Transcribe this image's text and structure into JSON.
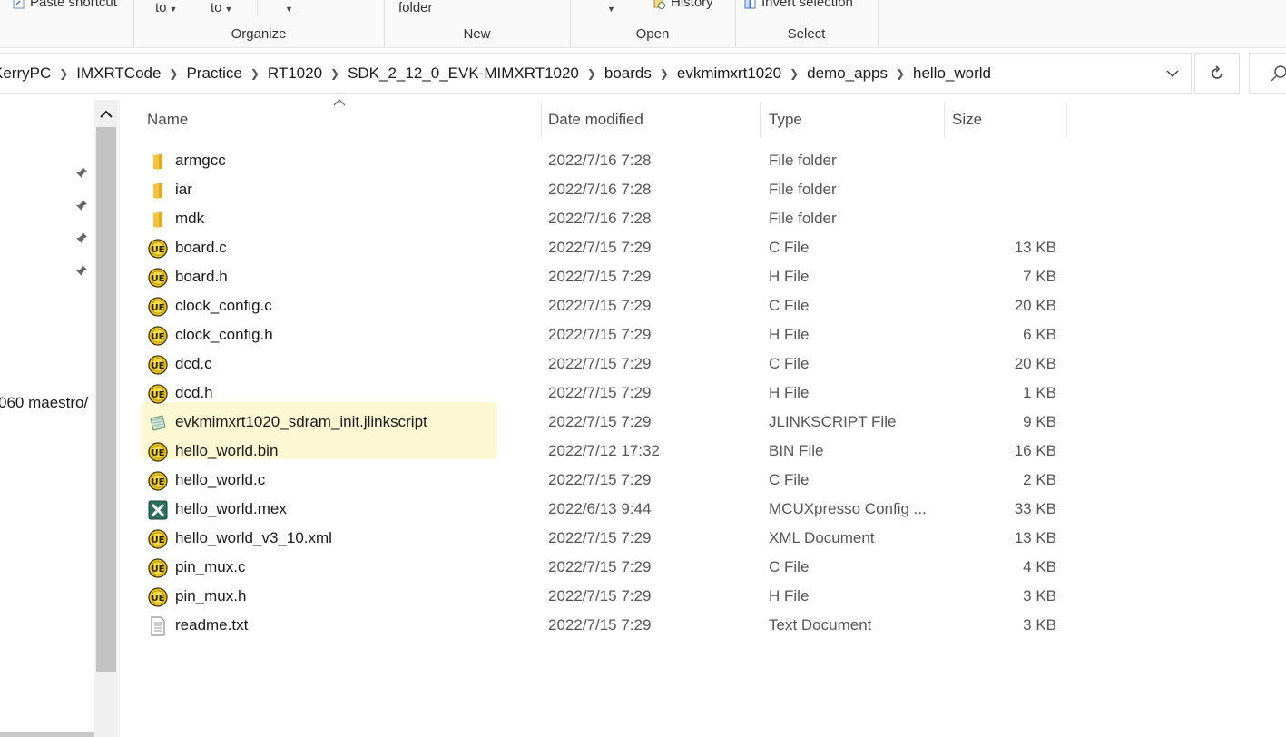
{
  "ribbon": {
    "clipboard_partial": "Paste shortcut",
    "organize": {
      "move_to": "to",
      "copy_to": "to",
      "label": "Organize"
    },
    "new": {
      "new_folder": "folder",
      "label": "New"
    },
    "open": {
      "history": "History",
      "label": "Open"
    },
    "select": {
      "invert_selection": "Invert selection",
      "label": "Select"
    }
  },
  "address_bar": {
    "crumbs": [
      "KerryPC",
      "IMXRTCode",
      "Practice",
      "RT1020",
      "SDK_2_12_0_EVK-MIMXRT1020",
      "boards",
      "evkmimxrt1020",
      "demo_apps",
      "hello_world"
    ]
  },
  "nav_pane": {
    "partial_item": "060 maestro/"
  },
  "columns": {
    "name": "Name",
    "date": "Date modified",
    "type": "Type",
    "size": "Size"
  },
  "files": [
    {
      "name": "armgcc",
      "date": "2022/7/16 7:28",
      "type": "File folder",
      "size": "",
      "icon": "folder-icon"
    },
    {
      "name": "iar",
      "date": "2022/7/16 7:28",
      "type": "File folder",
      "size": "",
      "icon": "folder-icon"
    },
    {
      "name": "mdk",
      "date": "2022/7/16 7:28",
      "type": "File folder",
      "size": "",
      "icon": "folder-icon"
    },
    {
      "name": "board.c",
      "date": "2022/7/15 7:29",
      "type": "C File",
      "size": "13 KB",
      "icon": "ultraedit-file-icon"
    },
    {
      "name": "board.h",
      "date": "2022/7/15 7:29",
      "type": "H File",
      "size": "7 KB",
      "icon": "ultraedit-file-icon"
    },
    {
      "name": "clock_config.c",
      "date": "2022/7/15 7:29",
      "type": "C File",
      "size": "20 KB",
      "icon": "ultraedit-file-icon"
    },
    {
      "name": "clock_config.h",
      "date": "2022/7/15 7:29",
      "type": "H File",
      "size": "6 KB",
      "icon": "ultraedit-file-icon"
    },
    {
      "name": "dcd.c",
      "date": "2022/7/15 7:29",
      "type": "C File",
      "size": "20 KB",
      "icon": "ultraedit-file-icon"
    },
    {
      "name": "dcd.h",
      "date": "2022/7/15 7:29",
      "type": "H File",
      "size": "1 KB",
      "icon": "ultraedit-file-icon"
    },
    {
      "name": "evkmimxrt1020_sdram_init.jlinkscript",
      "date": "2022/7/15 7:29",
      "type": "JLINKSCRIPT File",
      "size": "9 KB",
      "icon": "script-file-icon"
    },
    {
      "name": "hello_world.bin",
      "date": "2022/7/12 17:32",
      "type": "BIN File",
      "size": "16 KB",
      "icon": "ultraedit-file-icon"
    },
    {
      "name": "hello_world.c",
      "date": "2022/7/15 7:29",
      "type": "C File",
      "size": "2 KB",
      "icon": "ultraedit-file-icon"
    },
    {
      "name": "hello_world.mex",
      "date": "2022/6/13 9:44",
      "type": "MCUXpresso Config ...",
      "size": "33 KB",
      "icon": "mcuxpresso-file-icon"
    },
    {
      "name": "hello_world_v3_10.xml",
      "date": "2022/7/15 7:29",
      "type": "XML Document",
      "size": "13 KB",
      "icon": "ultraedit-file-icon"
    },
    {
      "name": "pin_mux.c",
      "date": "2022/7/15 7:29",
      "type": "C File",
      "size": "4 KB",
      "icon": "ultraedit-file-icon"
    },
    {
      "name": "pin_mux.h",
      "date": "2022/7/15 7:29",
      "type": "H File",
      "size": "3 KB",
      "icon": "ultraedit-file-icon"
    },
    {
      "name": "readme.txt",
      "date": "2022/7/15 7:29",
      "type": "Text Document",
      "size": "3 KB",
      "icon": "text-file-icon"
    }
  ],
  "colors": {
    "hover_highlight": "#fdf8d4",
    "folder": "#f5c342",
    "ultraedit_ring": "#b08a00"
  }
}
